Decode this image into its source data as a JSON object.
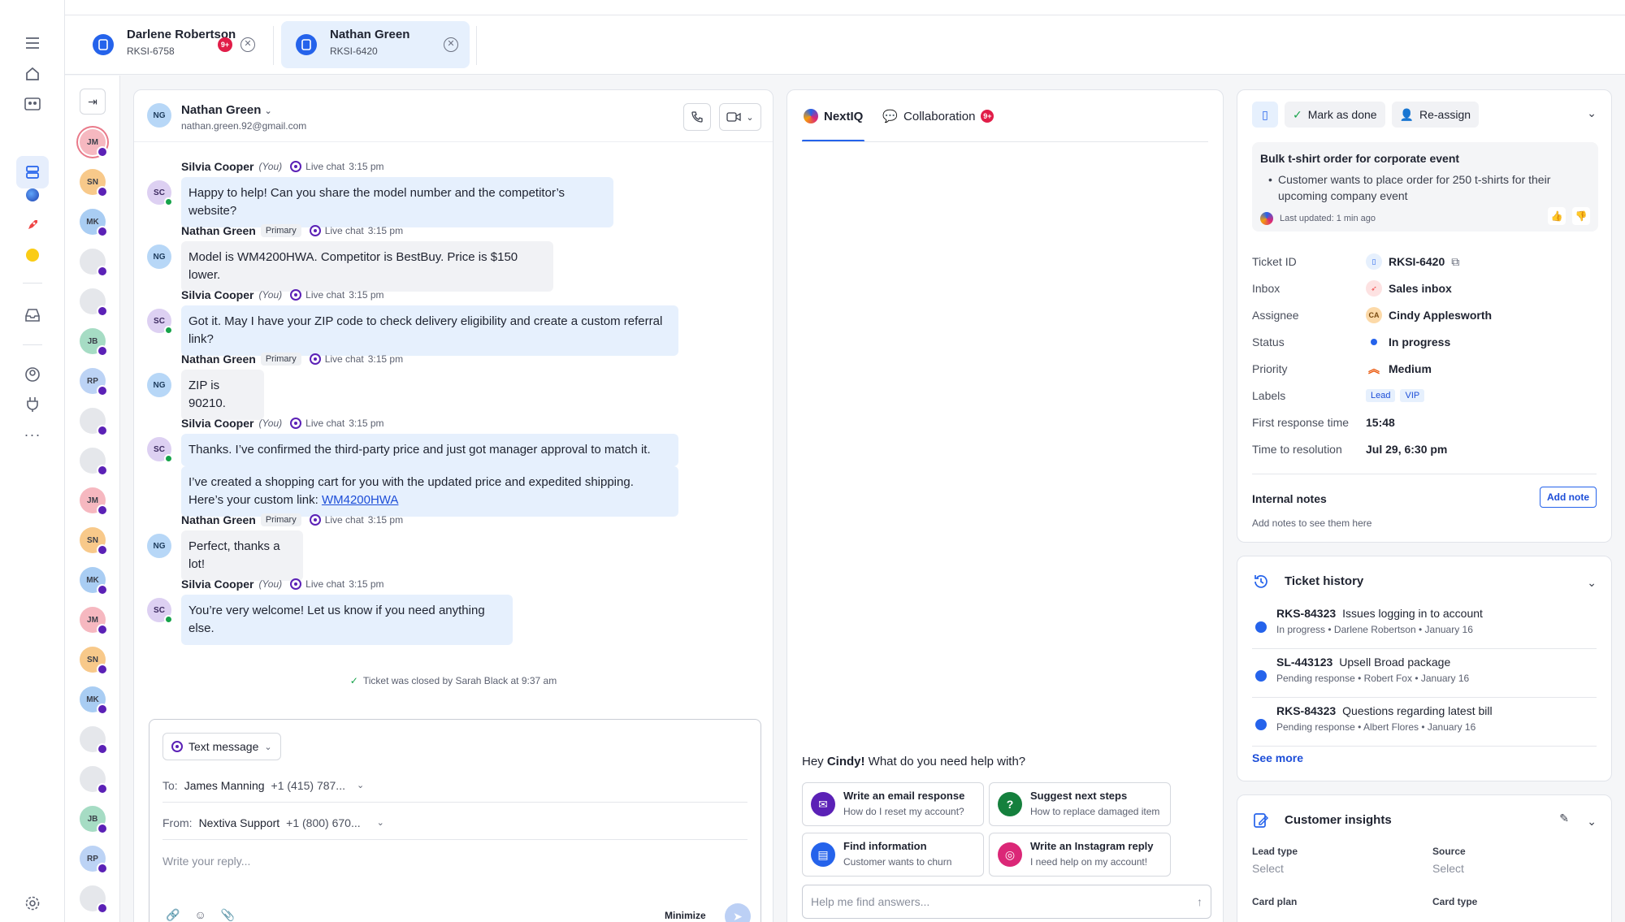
{
  "tabs": [
    {
      "name": "Darlene Robertson",
      "id": "RKSI-6758",
      "badge": "9+"
    },
    {
      "name": "Nathan Green",
      "id": "RKSI-6420"
    }
  ],
  "avatars": [
    "JM",
    "SN",
    "MK",
    "",
    "",
    "JB",
    "RP",
    "",
    "",
    "JM",
    "SN",
    "MK",
    "JM",
    "SN",
    "MK",
    "",
    "",
    "JB",
    "RP",
    ""
  ],
  "chat": {
    "contact_initials": "NG",
    "contact_name": "Nathan Green",
    "contact_email": "nathan.green.92@gmail.com",
    "messages": [
      {
        "sender": "Silvia Cooper",
        "you": "(You)",
        "channel": "Live chat",
        "time": "3:15 pm",
        "initials": "SC",
        "texts": [
          "Happy to help! Can you share the model number and the competitor’s website?"
        ]
      },
      {
        "sender": "Nathan Green",
        "tag": "Primary",
        "channel": "Live chat",
        "time": "3:15 pm",
        "initials": "NG",
        "texts": [
          "Model is WM4200HWA. Competitor is BestBuy. Price is $150 lower."
        ]
      },
      {
        "sender": "Silvia Cooper",
        "you": "(You)",
        "channel": "Live chat",
        "time": "3:15 pm",
        "initials": "SC",
        "texts": [
          "Got it. May I have your ZIP code to check delivery eligibility and create a custom referral link?"
        ]
      },
      {
        "sender": "Nathan Green",
        "tag": "Primary",
        "channel": "Live chat",
        "time": "3:15 pm",
        "initials": "NG",
        "texts": [
          "ZIP is 90210."
        ]
      },
      {
        "sender": "Silvia Cooper",
        "you": "(You)",
        "channel": "Live chat",
        "time": "3:15 pm",
        "initials": "SC",
        "texts": [
          "Thanks. I’ve confirmed the third-party price and just got manager approval to match it.",
          "I’ve created a shopping cart for you with the updated price and expedited shipping. Here’s your custom link: "
        ],
        "link": "WM4200HWA"
      },
      {
        "sender": "Nathan Green",
        "tag": "Primary",
        "channel": "Live chat",
        "time": "3:15 pm",
        "initials": "NG",
        "texts": [
          "Perfect, thanks a lot!"
        ]
      },
      {
        "sender": "Silvia Cooper",
        "you": "(You)",
        "channel": "Live chat",
        "time": "3:15 pm",
        "initials": "SC",
        "texts": [
          "You’re very welcome! Let us know if you need anything else."
        ]
      }
    ],
    "system_note": "Ticket was closed by Sarah Black at 9:37 am"
  },
  "composer": {
    "channel": "Text message",
    "to_label": "To:",
    "to_name": "James Manning",
    "to_phone": "+1 (415) 787...",
    "from_label": "From:",
    "from_name": "Nextiva Support",
    "from_phone": "+1 (800) 670...",
    "placeholder": "Write your reply...",
    "minimize": "Minimize"
  },
  "nextiq": {
    "tab_nextiq": "NextIQ",
    "tab_collab": "Collaboration",
    "collab_badge": "9+",
    "greeting_pre": "Hey ",
    "greeting_name": "Cindy!",
    "greeting_post": " What do you need help with?",
    "suggestions": [
      {
        "title": "Write an email response",
        "sub": "How do I reset my account?",
        "color": "#5b21b6"
      },
      {
        "title": "Suggest next steps",
        "sub": "How to replace damaged item",
        "color": "#15803d"
      },
      {
        "title": "Find information",
        "sub": "Customer wants to churn",
        "color": "#2563eb"
      },
      {
        "title": "Write an Instagram reply",
        "sub": "I need help on my account!",
        "color": "#db2777"
      }
    ],
    "ask_placeholder": "Help me find answers..."
  },
  "details": {
    "mark_done": "Mark as done",
    "reassign": "Re-assign",
    "summary_title": "Bulk t-shirt order for corporate event",
    "summary_body": "Customer wants to place order for 250 t-shirts for their upcoming company event",
    "summary_updated": "Last updated: 1 min ago",
    "fields": {
      "ticket_id_k": "Ticket ID",
      "ticket_id_v": "RKSI-6420",
      "inbox_k": "Inbox",
      "inbox_v": "Sales inbox",
      "assignee_k": "Assignee",
      "assignee_v": "Cindy Applesworth",
      "assignee_initials": "CA",
      "status_k": "Status",
      "status_v": "In progress",
      "priority_k": "Priority",
      "priority_v": "Medium",
      "labels_k": "Labels",
      "label1": "Lead",
      "label2": "VIP",
      "frt_k": "First response time",
      "frt_v": "15:48",
      "ttr_k": "Time to resolution",
      "ttr_v": "Jul 29, 6:30 pm"
    },
    "notes_title": "Internal notes",
    "notes_empty": "Add notes to see them here",
    "add_note": "Add note"
  },
  "history": {
    "title": "Ticket history",
    "items": [
      {
        "id": "RKS-84323",
        "title": "Issues logging in to account",
        "status": "In progress",
        "person": "Darlene Robertson",
        "date": "January 16"
      },
      {
        "id": "SL-443123",
        "title": "Upsell Broad package",
        "status": "Pending response",
        "person": "Robert Fox",
        "date": "January 16"
      },
      {
        "id": "RKS-84323",
        "title": "Questions regarding latest bill",
        "status": "Pending response",
        "person": "Albert Flores",
        "date": "January 16"
      }
    ],
    "see_more": "See more"
  },
  "insights": {
    "title": "Customer insights",
    "lead_type": "Lead type",
    "source": "Source",
    "select1": "Select",
    "select2": "Select",
    "card_plan": "Card plan",
    "card_type": "Card type"
  },
  "colors": {
    "accent": "#2563eb",
    "badge": "#e11d48",
    "livechat": "#5b21b6"
  }
}
